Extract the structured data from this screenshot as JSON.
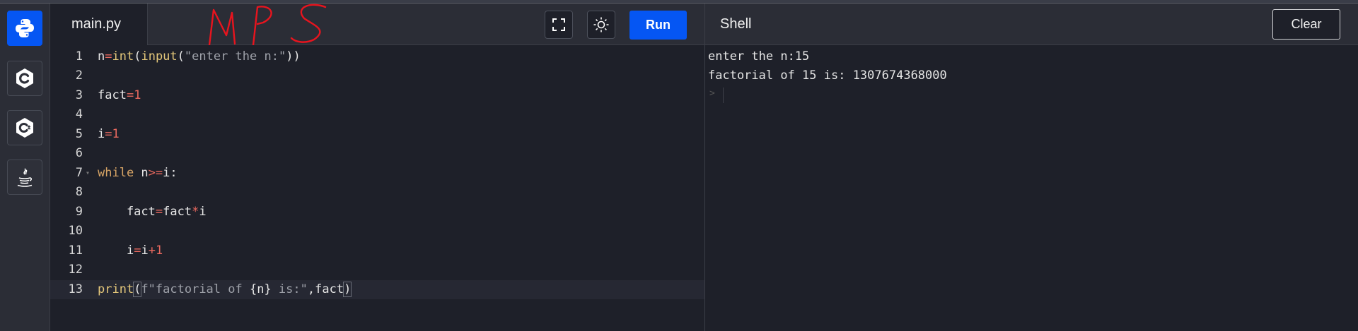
{
  "sidebar": {
    "languages": [
      {
        "name": "python-icon",
        "active": true
      },
      {
        "name": "c-icon",
        "active": false
      },
      {
        "name": "cpp-icon",
        "active": false
      },
      {
        "name": "java-icon",
        "active": false
      }
    ]
  },
  "editor": {
    "tab_label": "main.py",
    "run_label": "Run",
    "icons": [
      "fullscreen-icon",
      "theme-toggle-icon"
    ],
    "lines": [
      {
        "no": "1",
        "code": "n=int(input(\"enter the n:\"))"
      },
      {
        "no": "2",
        "code": ""
      },
      {
        "no": "3",
        "code": "fact=1"
      },
      {
        "no": "4",
        "code": ""
      },
      {
        "no": "5",
        "code": "i=1"
      },
      {
        "no": "6",
        "code": ""
      },
      {
        "no": "7",
        "code": "while n>=i:"
      },
      {
        "no": "8",
        "code": ""
      },
      {
        "no": "9",
        "code": "    fact=fact*i"
      },
      {
        "no": "10",
        "code": ""
      },
      {
        "no": "11",
        "code": "    i=i+1"
      },
      {
        "no": "12",
        "code": ""
      },
      {
        "no": "13",
        "code": "print(f\"factorial of {n} is:\",fact)"
      }
    ]
  },
  "shell": {
    "title": "Shell",
    "clear_label": "Clear",
    "output": [
      "enter the n:15",
      "factorial of 15 is: 1307674368000"
    ],
    "prompt": ">"
  },
  "annotation": {
    "text": "MPS",
    "color": "#e8141e"
  },
  "colors": {
    "accent": "#0556f3",
    "background": "#1e2029",
    "panel": "#2b2d36"
  }
}
